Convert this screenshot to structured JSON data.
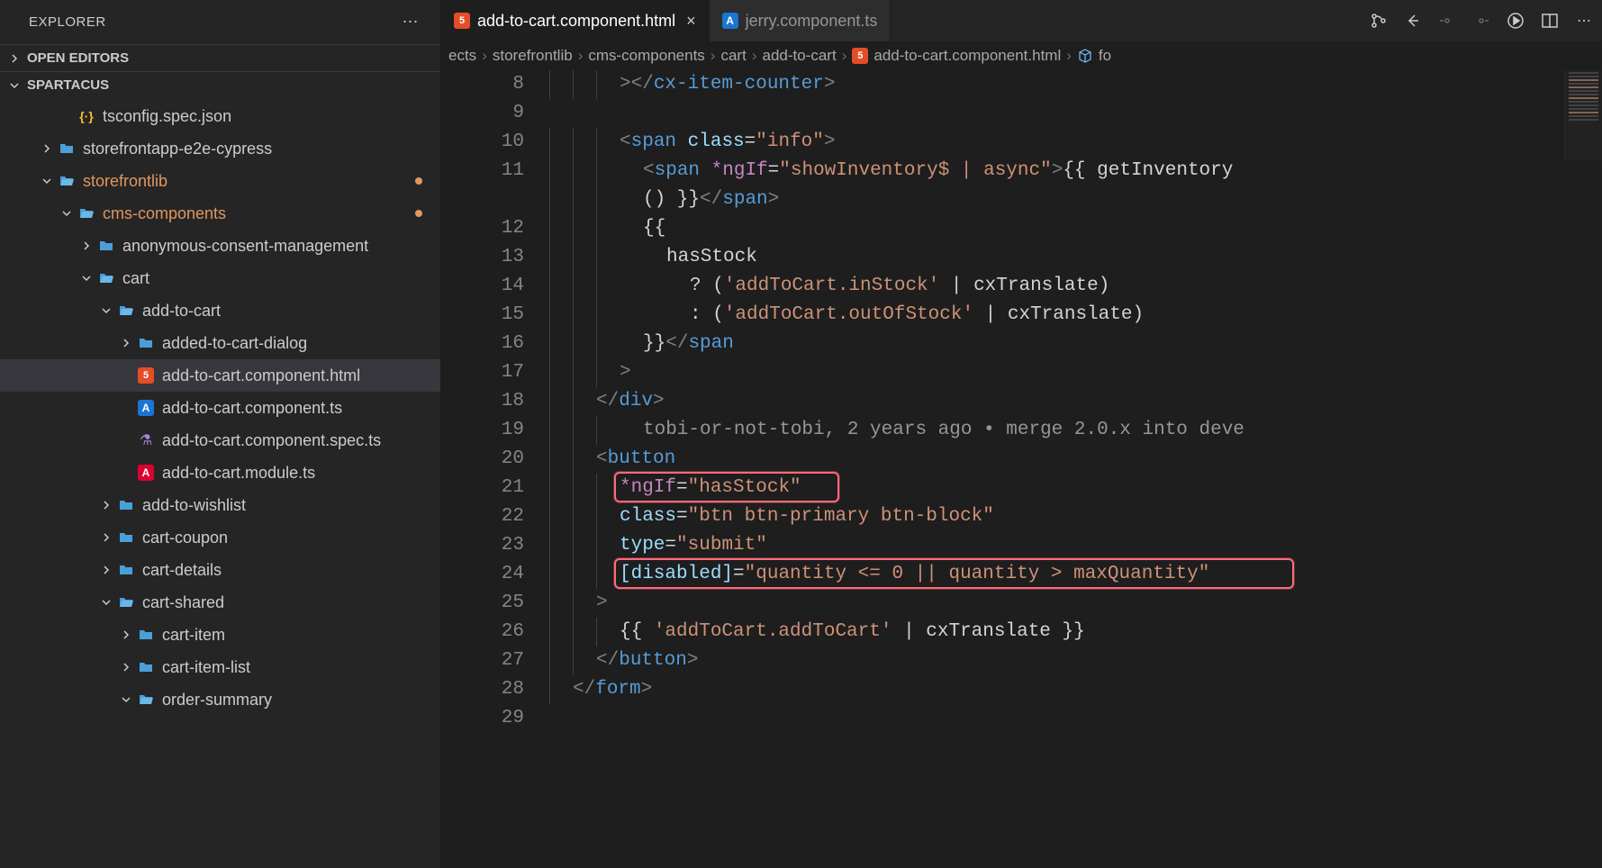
{
  "sidebar": {
    "title": "EXPLORER",
    "sections": {
      "openEditors": "OPEN EDITORS",
      "workspace": "SPARTACUS"
    },
    "tree": [
      {
        "indent": 2,
        "chev": "",
        "icon": "json",
        "label": "tsconfig.spec.json"
      },
      {
        "indent": 1,
        "chev": "right",
        "icon": "folder",
        "label": "storefrontapp-e2e-cypress"
      },
      {
        "indent": 1,
        "chev": "down",
        "icon": "folder-open",
        "label": "storefrontlib",
        "modified": true,
        "dot": true
      },
      {
        "indent": 2,
        "chev": "down",
        "icon": "folder-open",
        "label": "cms-components",
        "modified": true,
        "dot": true
      },
      {
        "indent": 3,
        "chev": "right",
        "icon": "folder",
        "label": "anonymous-consent-management"
      },
      {
        "indent": 3,
        "chev": "down",
        "icon": "folder-open",
        "label": "cart"
      },
      {
        "indent": 4,
        "chev": "down",
        "icon": "folder-open",
        "label": "add-to-cart"
      },
      {
        "indent": 5,
        "chev": "right",
        "icon": "folder",
        "label": "added-to-cart-dialog"
      },
      {
        "indent": 5,
        "chev": "",
        "icon": "html5",
        "label": "add-to-cart.component.html",
        "selected": true
      },
      {
        "indent": 5,
        "chev": "",
        "icon": "angular-blue",
        "label": "add-to-cart.component.ts"
      },
      {
        "indent": 5,
        "chev": "",
        "icon": "flask",
        "label": "add-to-cart.component.spec.ts"
      },
      {
        "indent": 5,
        "chev": "",
        "icon": "angular",
        "label": "add-to-cart.module.ts"
      },
      {
        "indent": 4,
        "chev": "right",
        "icon": "folder",
        "label": "add-to-wishlist"
      },
      {
        "indent": 4,
        "chev": "right",
        "icon": "folder",
        "label": "cart-coupon"
      },
      {
        "indent": 4,
        "chev": "right",
        "icon": "folder",
        "label": "cart-details"
      },
      {
        "indent": 4,
        "chev": "down",
        "icon": "folder-open",
        "label": "cart-shared"
      },
      {
        "indent": 5,
        "chev": "right",
        "icon": "folder",
        "label": "cart-item"
      },
      {
        "indent": 5,
        "chev": "right",
        "icon": "folder",
        "label": "cart-item-list"
      },
      {
        "indent": 5,
        "chev": "down",
        "icon": "folder-open",
        "label": "order-summary"
      }
    ]
  },
  "tabs": [
    {
      "icon": "html5",
      "label": "add-to-cart.component.html",
      "active": true,
      "close": true
    },
    {
      "icon": "angular-blue",
      "label": "jerry.component.ts",
      "active": false
    }
  ],
  "breadcrumb": [
    {
      "label": "ects"
    },
    {
      "label": "storefrontlib"
    },
    {
      "label": "cms-components"
    },
    {
      "label": "cart"
    },
    {
      "label": "add-to-cart"
    },
    {
      "label": "add-to-cart.component.html",
      "icon": "html5"
    },
    {
      "label": "fo",
      "icon": "cube"
    }
  ],
  "code": {
    "startLine": 8,
    "lines": [
      {
        "n": 8,
        "indent": 3,
        "html": "<span class='tok-bracket'>&gt;&lt;/</span><span class='tok-tag'>cx-item-counter</span><span class='tok-bracket'>&gt;</span>"
      },
      {
        "n": 9,
        "indent": 0,
        "html": ""
      },
      {
        "n": 10,
        "indent": 3,
        "html": "<span class='tok-bracket'>&lt;</span><span class='tok-tag'>span</span> <span class='tok-attr'>class</span><span class='tok-punc'>=</span><span class='tok-str'>\"info\"</span><span class='tok-bracket'>&gt;</span>"
      },
      {
        "n": 11,
        "indent": 4,
        "html": "<span class='tok-bracket'>&lt;</span><span class='tok-tag'>span</span> <span class='tok-dir'>*ngIf</span><span class='tok-punc'>=</span><span class='tok-str'>\"showInventory$ | async\"</span><span class='tok-bracket'>&gt;</span><span class='tok-text'>{{ getInventory</span>"
      },
      {
        "n": "",
        "indent": 4,
        "html": "<span class='tok-text'>() }}</span><span class='tok-bracket'>&lt;/</span><span class='tok-tag'>span</span><span class='tok-bracket'>&gt;</span>"
      },
      {
        "n": 12,
        "indent": 4,
        "html": "<span class='tok-text'>{{</span>"
      },
      {
        "n": 13,
        "indent": 5,
        "html": "<span class='tok-text'>hasStock</span>"
      },
      {
        "n": 14,
        "indent": 6,
        "html": "<span class='tok-text'>? (</span><span class='tok-str'>'addToCart.inStock'</span><span class='tok-text'> | cxTranslate)</span>"
      },
      {
        "n": 15,
        "indent": 6,
        "html": "<span class='tok-text'>: (</span><span class='tok-str'>'addToCart.outOfStock'</span><span class='tok-text'> | cxTranslate)</span>"
      },
      {
        "n": 16,
        "indent": 4,
        "html": "<span class='tok-text'>}}</span><span class='tok-bracket'>&lt;/</span><span class='tok-tag'>span</span>"
      },
      {
        "n": 17,
        "indent": 3,
        "html": "<span class='tok-bracket'>&gt;</span>"
      },
      {
        "n": 18,
        "indent": 2,
        "html": "<span class='tok-bracket'>&lt;/</span><span class='tok-tag'>div</span><span class='tok-bracket'>&gt;</span>"
      },
      {
        "n": 19,
        "indent": 4,
        "html": "<span class='tok-lens'>tobi-or-not-tobi, 2 years ago • merge 2.0.x into deve</span>"
      },
      {
        "n": 20,
        "indent": 2,
        "html": "<span class='tok-bracket'>&lt;</span><span class='tok-tag'>button</span>"
      },
      {
        "n": 21,
        "indent": 3,
        "html": "<span class='tok-dir'>*ngIf</span><span class='tok-punc'>=</span><span class='tok-str'>\"hasStock\"</span>",
        "highlight": 1
      },
      {
        "n": 22,
        "indent": 3,
        "html": "<span class='tok-attr'>class</span><span class='tok-punc'>=</span><span class='tok-str'>\"btn btn-primary btn-block\"</span>"
      },
      {
        "n": 23,
        "indent": 3,
        "html": "<span class='tok-attr'>type</span><span class='tok-punc'>=</span><span class='tok-str'>\"submit\"</span>"
      },
      {
        "n": 24,
        "indent": 3,
        "html": "<span class='tok-bind'>[disabled]</span><span class='tok-punc'>=</span><span class='tok-str'>\"quantity &lt;= 0 || quantity &gt; maxQuantity\"</span>",
        "highlight": 2
      },
      {
        "n": 25,
        "indent": 2,
        "html": "<span class='tok-bracket'>&gt;</span>"
      },
      {
        "n": 26,
        "indent": 3,
        "html": "<span class='tok-text'>{{ </span><span class='tok-str'>'addToCart.addToCart'</span><span class='tok-text'> | cxTranslate }}</span>"
      },
      {
        "n": 27,
        "indent": 2,
        "html": "<span class='tok-bracket'>&lt;/</span><span class='tok-tag'>button</span><span class='tok-bracket'>&gt;</span>"
      },
      {
        "n": 28,
        "indent": 1,
        "html": "<span class='tok-bracket'>&lt;/</span><span class='tok-tag'>form</span><span class='tok-bracket'>&gt;</span>"
      },
      {
        "n": 29,
        "indent": 0,
        "html": ""
      }
    ]
  }
}
